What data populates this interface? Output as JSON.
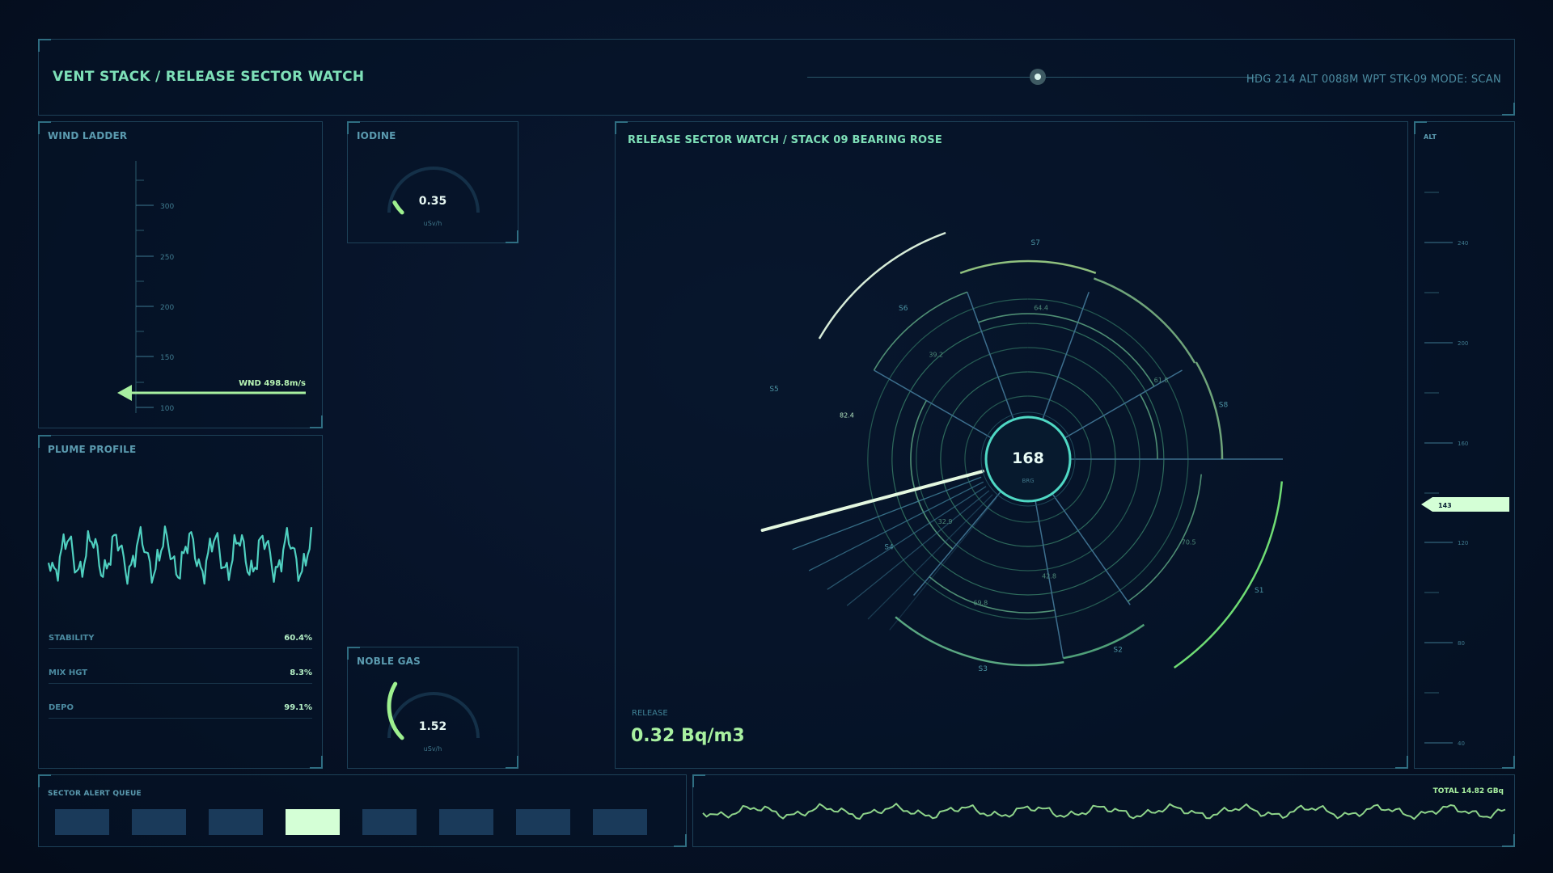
{
  "header": {
    "title": "VENT STACK / RELEASE SECTOR WATCH",
    "status": "HDG 214  ALT 0088M  WPT STK-09  MODE: SCAN"
  },
  "wind_ladder": {
    "title": "WIND LADDER",
    "ticks": [
      "300",
      "250",
      "200",
      "150",
      "100"
    ],
    "readout": "WND 498.8m/s"
  },
  "plume": {
    "title": "PLUME PROFILE",
    "stats": [
      {
        "label": "STABILITY",
        "value": "60.4%"
      },
      {
        "label": "MIX HGT",
        "value": "8.3%"
      },
      {
        "label": "DEPO",
        "value": "99.1%"
      }
    ]
  },
  "iodine": {
    "title": "IODINE",
    "value": "0.35",
    "unit": "uSv/h",
    "fraction": 0.06
  },
  "noble_gas": {
    "title": "NOBLE GAS",
    "value": "1.52",
    "unit": "uSv/h",
    "fraction": 0.28
  },
  "rose": {
    "title": "RELEASE SECTOR WATCH / STACK 09  BEARING ROSE",
    "center_value": "168",
    "center_label": "BRG",
    "sectors": [
      "S1",
      "S2",
      "S3",
      "S4",
      "S5",
      "S6",
      "S7",
      "S8"
    ],
    "values": [
      "70.5",
      "42.8",
      "69.8",
      "32.9",
      "82.4",
      "39.2",
      "64.4",
      "61.8"
    ],
    "release_label": "RELEASE",
    "release_value": "0.32 Bq/m3"
  },
  "alt_tape": {
    "title": "ALT",
    "ticks": [
      "240",
      "200",
      "160",
      "120",
      "80",
      "40"
    ],
    "current": "143"
  },
  "alert_queue": {
    "title": "SECTOR ALERT QUEUE",
    "active_index": 3,
    "count": 8
  },
  "total": {
    "label": "TOTAL 14.82 GBq"
  },
  "colors": {
    "accent": "#7ee0b8",
    "highlight": "#d4ffd6",
    "grid": "#1d4158"
  }
}
